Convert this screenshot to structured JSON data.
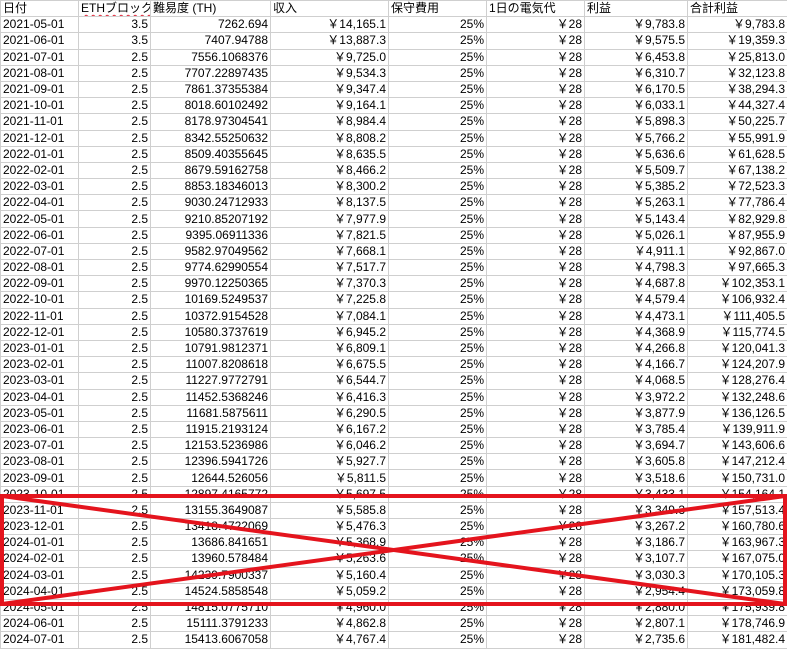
{
  "headers": [
    "日付",
    "ETHブロック報酬",
    "難易度 (TH)",
    "収入",
    "保守費用",
    "1日の電気代",
    "利益",
    "合計利益"
  ],
  "rows": [
    [
      "2021-05-01",
      "3.5",
      "7262.694",
      "￥14,165.1",
      "25%",
      "￥28",
      "￥9,783.8",
      "￥9,783.8"
    ],
    [
      "2021-06-01",
      "3.5",
      "7407.94788",
      "￥13,887.3",
      "25%",
      "￥28",
      "￥9,575.5",
      "￥19,359.3"
    ],
    [
      "2021-07-01",
      "2.5",
      "7556.1068376",
      "￥9,725.0",
      "25%",
      "￥28",
      "￥6,453.8",
      "￥25,813.0"
    ],
    [
      "2021-08-01",
      "2.5",
      "7707.22897435",
      "￥9,534.3",
      "25%",
      "￥28",
      "￥6,310.7",
      "￥32,123.8"
    ],
    [
      "2021-09-01",
      "2.5",
      "7861.37355384",
      "￥9,347.4",
      "25%",
      "￥28",
      "￥6,170.5",
      "￥38,294.3"
    ],
    [
      "2021-10-01",
      "2.5",
      "8018.60102492",
      "￥9,164.1",
      "25%",
      "￥28",
      "￥6,033.1",
      "￥44,327.4"
    ],
    [
      "2021-11-01",
      "2.5",
      "8178.97304541",
      "￥8,984.4",
      "25%",
      "￥28",
      "￥5,898.3",
      "￥50,225.7"
    ],
    [
      "2021-12-01",
      "2.5",
      "8342.55250632",
      "￥8,808.2",
      "25%",
      "￥28",
      "￥5,766.2",
      "￥55,991.9"
    ],
    [
      "2022-01-01",
      "2.5",
      "8509.40355645",
      "￥8,635.5",
      "25%",
      "￥28",
      "￥5,636.6",
      "￥61,628.5"
    ],
    [
      "2022-02-01",
      "2.5",
      "8679.59162758",
      "￥8,466.2",
      "25%",
      "￥28",
      "￥5,509.7",
      "￥67,138.2"
    ],
    [
      "2022-03-01",
      "2.5",
      "8853.18346013",
      "￥8,300.2",
      "25%",
      "￥28",
      "￥5,385.2",
      "￥72,523.3"
    ],
    [
      "2022-04-01",
      "2.5",
      "9030.24712933",
      "￥8,137.5",
      "25%",
      "￥28",
      "￥5,263.1",
      "￥77,786.4"
    ],
    [
      "2022-05-01",
      "2.5",
      "9210.85207192",
      "￥7,977.9",
      "25%",
      "￥28",
      "￥5,143.4",
      "￥82,929.8"
    ],
    [
      "2022-06-01",
      "2.5",
      "9395.06911336",
      "￥7,821.5",
      "25%",
      "￥28",
      "￥5,026.1",
      "￥87,955.9"
    ],
    [
      "2022-07-01",
      "2.5",
      "9582.97049562",
      "￥7,668.1",
      "25%",
      "￥28",
      "￥4,911.1",
      "￥92,867.0"
    ],
    [
      "2022-08-01",
      "2.5",
      "9774.62990554",
      "￥7,517.7",
      "25%",
      "￥28",
      "￥4,798.3",
      "￥97,665.3"
    ],
    [
      "2022-09-01",
      "2.5",
      "9970.12250365",
      "￥7,370.3",
      "25%",
      "￥28",
      "￥4,687.8",
      "￥102,353.1"
    ],
    [
      "2022-10-01",
      "2.5",
      "10169.5249537",
      "￥7,225.8",
      "25%",
      "￥28",
      "￥4,579.4",
      "￥106,932.4"
    ],
    [
      "2022-11-01",
      "2.5",
      "10372.9154528",
      "￥7,084.1",
      "25%",
      "￥28",
      "￥4,473.1",
      "￥111,405.5"
    ],
    [
      "2022-12-01",
      "2.5",
      "10580.3737619",
      "￥6,945.2",
      "25%",
      "￥28",
      "￥4,368.9",
      "￥115,774.5"
    ],
    [
      "2023-01-01",
      "2.5",
      "10791.9812371",
      "￥6,809.1",
      "25%",
      "￥28",
      "￥4,266.8",
      "￥120,041.3"
    ],
    [
      "2023-02-01",
      "2.5",
      "11007.8208618",
      "￥6,675.5",
      "25%",
      "￥28",
      "￥4,166.7",
      "￥124,207.9"
    ],
    [
      "2023-03-01",
      "2.5",
      "11227.9772791",
      "￥6,544.7",
      "25%",
      "￥28",
      "￥4,068.5",
      "￥128,276.4"
    ],
    [
      "2023-04-01",
      "2.5",
      "11452.5368246",
      "￥6,416.3",
      "25%",
      "￥28",
      "￥3,972.2",
      "￥132,248.6"
    ],
    [
      "2023-05-01",
      "2.5",
      "11681.5875611",
      "￥6,290.5",
      "25%",
      "￥28",
      "￥3,877.9",
      "￥136,126.5"
    ],
    [
      "2023-06-01",
      "2.5",
      "11915.2193124",
      "￥6,167.2",
      "25%",
      "￥28",
      "￥3,785.4",
      "￥139,911.9"
    ],
    [
      "2023-07-01",
      "2.5",
      "12153.5236986",
      "￥6,046.2",
      "25%",
      "￥28",
      "￥3,694.7",
      "￥143,606.6"
    ],
    [
      "2023-08-01",
      "2.5",
      "12396.5941726",
      "￥5,927.7",
      "25%",
      "￥28",
      "￥3,605.8",
      "￥147,212.4"
    ],
    [
      "2023-09-01",
      "2.5",
      "12644.526056",
      "￥5,811.5",
      "25%",
      "￥28",
      "￥3,518.6",
      "￥150,731.0"
    ],
    [
      "2023-10-01",
      "2.5",
      "12897.4165772",
      "￥5,697.5",
      "25%",
      "￥28",
      "￥3,433.1",
      "￥154,164.1"
    ],
    [
      "2023-11-01",
      "2.5",
      "13155.3649087",
      "￥5,585.8",
      "25%",
      "￥28",
      "￥3,349.3",
      "￥157,513.4"
    ],
    [
      "2023-12-01",
      "2.5",
      "13418.4722069",
      "￥5,476.3",
      "25%",
      "￥28",
      "￥3,267.2",
      "￥160,780.6"
    ],
    [
      "2024-01-01",
      "2.5",
      "13686.841651",
      "￥5,368.9",
      "25%",
      "￥28",
      "￥3,186.7",
      "￥163,967.3"
    ],
    [
      "2024-02-01",
      "2.5",
      "13960.578484",
      "￥5,263.6",
      "25%",
      "￥28",
      "￥3,107.7",
      "￥167,075.0"
    ],
    [
      "2024-03-01",
      "2.5",
      "14239.7900337",
      "￥5,160.4",
      "25%",
      "￥28",
      "￥3,030.3",
      "￥170,105.3"
    ],
    [
      "2024-04-01",
      "2.5",
      "14524.5858548",
      "￥5,059.2",
      "25%",
      "￥28",
      "￥2,954.4",
      "￥173,059.8"
    ],
    [
      "2024-05-01",
      "2.5",
      "14815.0775710",
      "￥4,960.0",
      "25%",
      "￥28",
      "￥2,880.0",
      "￥175,939.8"
    ],
    [
      "2024-06-01",
      "2.5",
      "15111.3791233",
      "￥4,862.8",
      "25%",
      "￥28",
      "￥2,807.1",
      "￥178,746.9"
    ],
    [
      "2024-07-01",
      "2.5",
      "15413.6067058",
      "￥4,767.4",
      "25%",
      "￥28",
      "￥2,735.6",
      "￥181,482.4"
    ]
  ],
  "highlight": {
    "color": "#e4141d"
  }
}
